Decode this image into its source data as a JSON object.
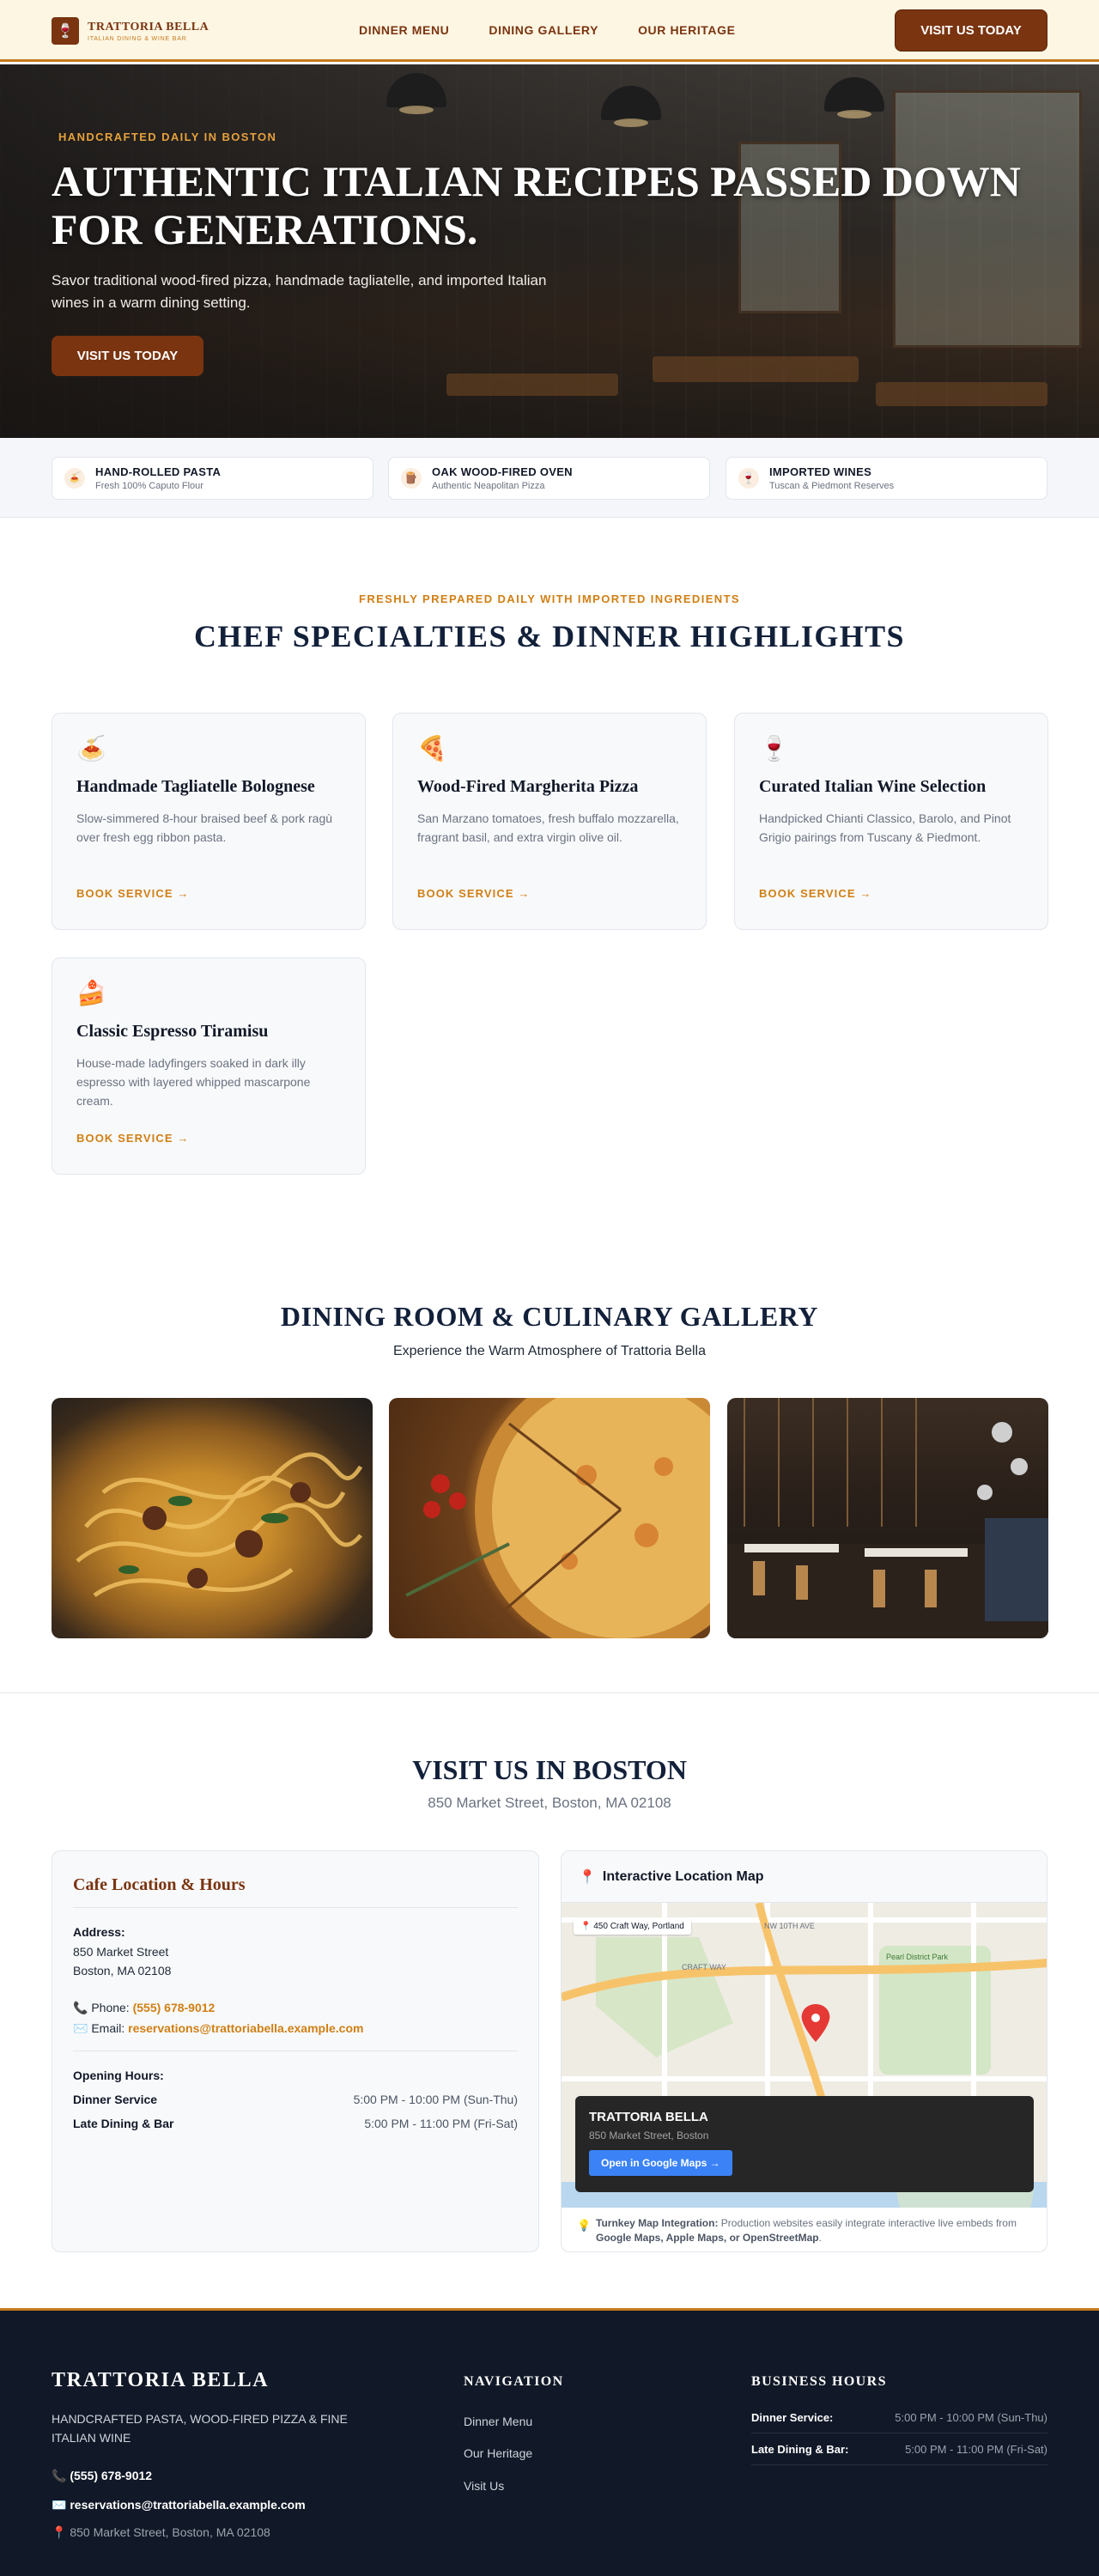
{
  "header": {
    "brand_name": "TRATTORIA BELLA",
    "brand_tagline": "ITALIAN DINING & WINE BAR",
    "nav": [
      "DINNER MENU",
      "DINING GALLERY",
      "OUR HERITAGE"
    ],
    "cta": "VISIT US TODAY"
  },
  "hero": {
    "eyebrow": "HANDCRAFTED DAILY IN BOSTON",
    "title": "AUTHENTIC ITALIAN RECIPES PASSED DOWN FOR GENERATIONS.",
    "description": "Savor traditional wood-fired pizza, handmade tagliatelle, and imported Italian wines in a warm dining setting.",
    "cta": "VISIT US TODAY"
  },
  "features": [
    {
      "icon": "pasta-icon",
      "title": "HAND-ROLLED PASTA",
      "subtitle": "Fresh 100% Caputo Flour"
    },
    {
      "icon": "wood-icon",
      "title": "OAK WOOD-FIRED OVEN",
      "subtitle": "Authentic Neapolitan Pizza"
    },
    {
      "icon": "wine-icon",
      "title": "IMPORTED WINES",
      "subtitle": "Tuscan & Piedmont Reserves"
    }
  ],
  "specialties": {
    "eyebrow": "FRESHLY PREPARED DAILY WITH IMPORTED INGREDIENTS",
    "title": "CHEF SPECIALTIES & DINNER HIGHLIGHTS",
    "items": [
      {
        "icon": "spaghetti-icon",
        "title": "Handmade Tagliatelle Bolognese",
        "description": "Slow-simmered 8-hour braised beef & pork ragù over fresh egg ribbon pasta.",
        "link": "BOOK SERVICE →"
      },
      {
        "icon": "pizza-icon",
        "title": "Wood-Fired Margherita Pizza",
        "description": "San Marzano tomatoes, fresh buffalo mozzarella, fragrant basil, and extra virgin olive oil.",
        "link": "BOOK SERVICE →"
      },
      {
        "icon": "wine-glass-icon",
        "title": "Curated Italian Wine Selection",
        "description": "Handpicked Chianti Classico, Barolo, and Pinot Grigio pairings from Tuscany & Piedmont.",
        "link": "BOOK SERVICE →"
      },
      {
        "icon": "cake-icon",
        "title": "Classic Espresso Tiramisu",
        "description": "House-made ladyfingers soaked in dark illy espresso with layered whipped mascarpone cream.",
        "link": "BOOK SERVICE →"
      }
    ]
  },
  "gallery": {
    "title": "DINING ROOM & CULINARY GALLERY",
    "subtitle": "Experience the Warm Atmosphere of Trattoria Bella"
  },
  "visit": {
    "title": "VISIT US IN BOSTON",
    "subtitle": "850 Market Street, Boston, MA 02108",
    "card_title": "Cafe Location & Hours",
    "address_label": "Address:",
    "address_line1": "850 Market Street",
    "address_line2": "Boston, MA 02108",
    "phone_label": "Phone:",
    "phone": "(555) 678-9012",
    "email_label": "Email:",
    "email": "reservations@trattoriabella.example.com",
    "hours_label": "Opening Hours:",
    "hours": [
      {
        "label": "Dinner Service",
        "value": "5:00 PM - 10:00 PM (Sun-Thu)"
      },
      {
        "label": "Late Dining & Bar",
        "value": "5:00 PM - 11:00 PM (Fri-Sat)"
      }
    ]
  },
  "map": {
    "title": "Interactive Location Map",
    "pin_label": "450 Craft Way, Portland",
    "street_1": "NW 10TH AVE",
    "street_2": "CRAFT WAY",
    "park": "Pearl District Park",
    "popup_title": "TRATTORIA BELLA",
    "popup_address": "850 Market Street, Boston",
    "popup_button": "Open in Google Maps →",
    "note_bold": "Turnkey Map Integration:",
    "note_text": "Production websites easily integrate interactive live embeds from",
    "note_providers": "Google Maps, Apple Maps, or OpenStreetMap",
    "note_end": "."
  },
  "footer": {
    "brand": "TRATTORIA BELLA",
    "tagline": "HANDCRAFTED PASTA, WOOD-FIRED PIZZA & FINE ITALIAN WINE",
    "phone": "(555) 678-9012",
    "email": "reservations@trattoriabella.example.com",
    "address": "850 Market Street, Boston, MA 02108",
    "nav_heading": "NAVIGATION",
    "nav_links": [
      "Dinner Menu",
      "Our Heritage",
      "Visit Us"
    ],
    "hours_heading": "BUSINESS HOURS",
    "hours": [
      {
        "label": "Dinner Service:",
        "value": "5:00 PM - 10:00 PM (Sun-Thu)"
      },
      {
        "label": "Late Dining & Bar:",
        "value": "5:00 PM - 11:00 PM (Fri-Sat)"
      }
    ]
  },
  "colors": {
    "brand": "#7a3410",
    "accent": "#d07f14",
    "navy": "#12203a",
    "footer_bg": "#111827"
  }
}
